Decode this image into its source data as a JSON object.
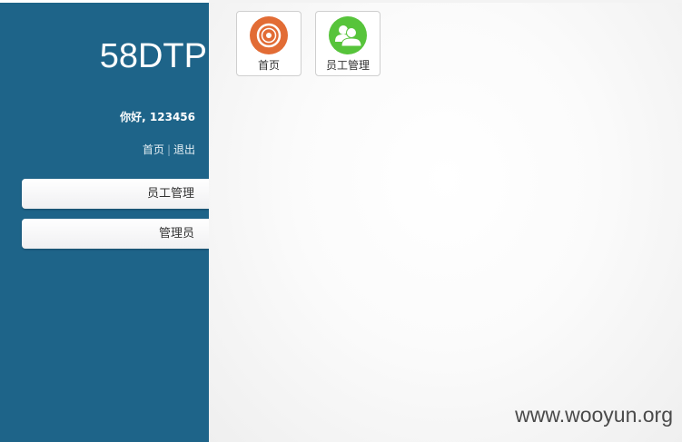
{
  "sidebar": {
    "logo": "58DTP",
    "greeting": "你好, 123456",
    "links": [
      {
        "label": "首页"
      },
      {
        "label": "退出"
      }
    ],
    "separator": "|",
    "nav_items": [
      {
        "label": "员工管理"
      },
      {
        "label": "管理员"
      }
    ],
    "bg_color": "#1e6489"
  },
  "shortcuts": [
    {
      "label": "首页",
      "icon": "target-icon",
      "color": "#e26c35"
    },
    {
      "label": "员工管理",
      "icon": "users-icon",
      "color": "#57c43b"
    }
  ],
  "watermark": "www.wooyun.org"
}
